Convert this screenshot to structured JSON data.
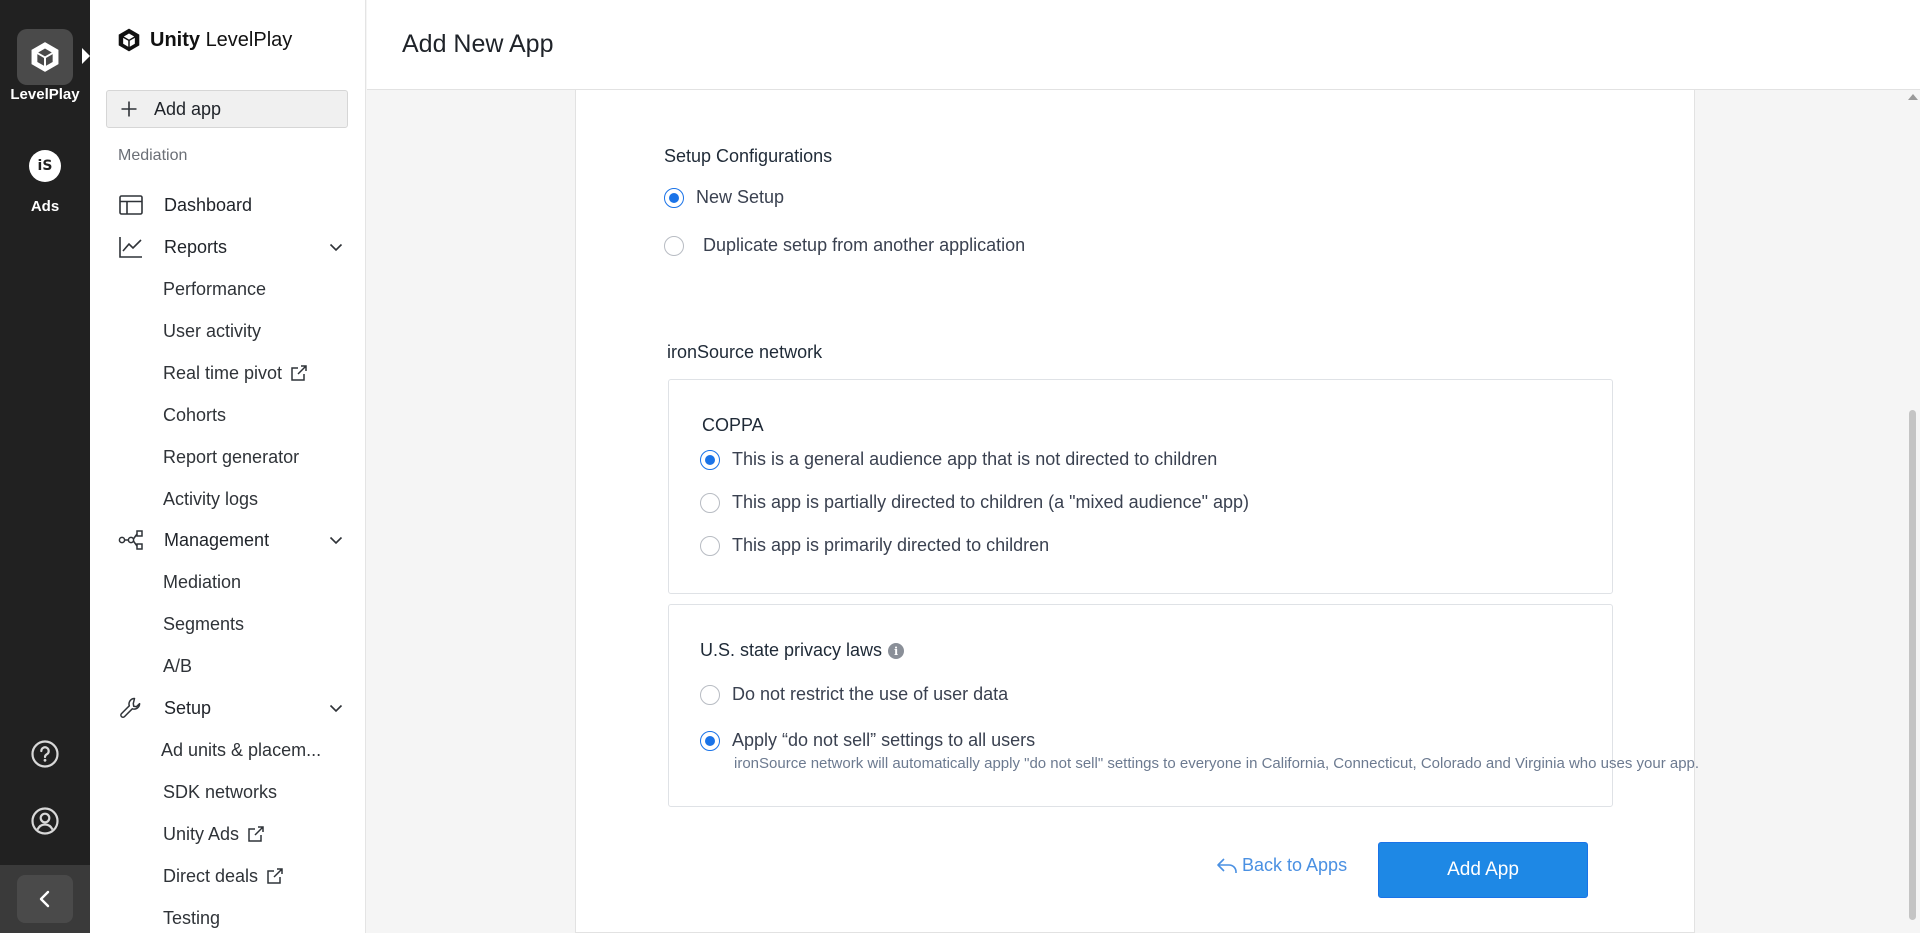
{
  "rail": {
    "levelplay_label": "LevelPlay",
    "ads_label": "Ads",
    "ads_badge": "iS",
    "help_icon": "question-circle-icon",
    "account_icon": "user-circle-icon",
    "collapse_icon": "chevron-left-icon"
  },
  "nav": {
    "logo_brand": "Unity",
    "logo_product": "LevelPlay",
    "add_app_label": "Add app",
    "section_label": "Mediation",
    "dashboard": "Dashboard",
    "reports": "Reports",
    "reports_items": [
      "Performance",
      "User activity",
      "Real time pivot",
      "Cohorts",
      "Report generator",
      "Activity logs"
    ],
    "management": "Management",
    "management_items": [
      "Mediation",
      "Segments",
      "A/B"
    ],
    "setup": "Setup",
    "setup_items": [
      "Ad units & placem...",
      "SDK networks",
      "Unity Ads",
      "Direct deals",
      "Testing"
    ]
  },
  "header": {
    "title": "Add New App"
  },
  "form": {
    "setup": {
      "label": "Setup Configurations",
      "options": [
        "New Setup",
        "Duplicate setup from another application"
      ],
      "selected": "New Setup"
    },
    "network_label": "ironSource network",
    "coppa": {
      "label": "COPPA",
      "options": [
        "This is a general audience app that is not directed to children",
        "This app is partially directed to children (a \"mixed audience\" app)",
        "This app is primarily directed to children"
      ],
      "selected": "This is a general audience app that is not directed to children"
    },
    "privacy": {
      "label": "U.S. state privacy laws",
      "info_glyph": "i",
      "options": [
        "Do not restrict the use of user data",
        "Apply “do not sell” settings to all users"
      ],
      "selected": "Apply “do not sell” settings to all users",
      "helper": "ironSource network will automatically apply \"do not sell\" settings to everyone in California, Connecticut, Colorado and Virginia who uses your app."
    },
    "back_label": "Back to Apps",
    "submit_label": "Add App"
  },
  "colors": {
    "accent": "#1e88e5",
    "link": "#4a90e2",
    "rail_bg": "#212121"
  }
}
